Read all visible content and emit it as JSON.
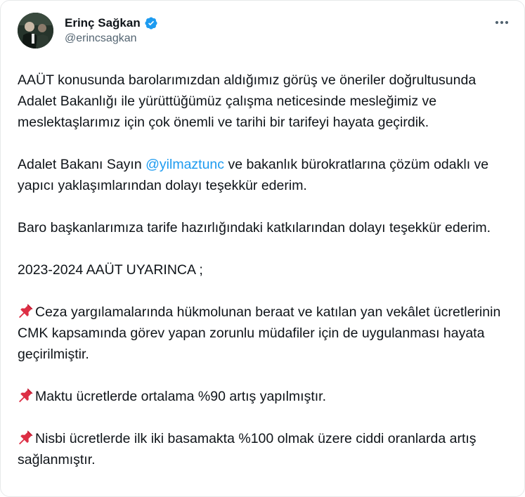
{
  "author": {
    "display_name": "Erinç Sağkan",
    "handle": "@erincsagkan",
    "verified_icon": "verified-badge-icon",
    "verified_color": "#1d9bf0"
  },
  "menu": {
    "icon": "more-options-icon"
  },
  "tweet": {
    "p1": "AAÜT konusunda barolarımızdan aldığımız görüş ve öneriler doğrultusunda Adalet Bakanlığı ile yürüttüğümüz çalışma neticesinde mesleğimiz ve meslektaşlarımız için çok önemli ve tarihi bir tarifeyi hayata geçirdik.",
    "p2_before": "Adalet Bakanı Sayın ",
    "p2_mention": "@yilmaztunc",
    "p2_after": " ve bakanlık bürokratlarına çözüm odaklı ve yapıcı yaklaşımlarından dolayı teşekkür ederim.",
    "p3": "Baro başkanlarımıza tarife hazırlığındaki katkılarından dolayı teşekkür ederim.",
    "p4": "2023-2024 AAÜT UYARINCA ;",
    "items": [
      "Ceza yargılamalarında hükmolunan beraat ve katılan yan vekâlet ücretlerinin CMK kapsamında görev yapan zorunlu müdafiler için de uygulanması hayata geçirilmiştir.",
      "Maktu ücretlerde ortalama %90 artış yapılmıştır.",
      "Nisbi ücretlerde ilk iki basamakta %100 olmak üzere ciddi oranlarda artış sağlanmıştır."
    ],
    "item_icon": "pushpin-icon",
    "mention_color": "#1d9bf0"
  }
}
